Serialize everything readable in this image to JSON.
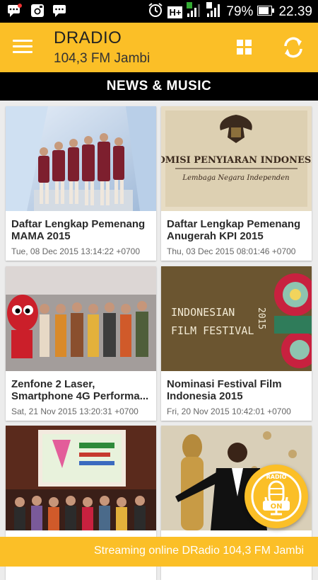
{
  "statusbar": {
    "battery_pct": "79%",
    "time": "22.39",
    "network": "H+",
    "sim1": "1",
    "sim2": "2"
  },
  "appbar": {
    "title": "DRADIO",
    "subtitle": "104,3 FM Jambi"
  },
  "section": {
    "title": "NEWS & MUSIC"
  },
  "cards": [
    {
      "title_line1": "Daftar Lengkap Pemenang",
      "title_line2": "MAMA 2015",
      "date": "Tue, 08 Dec 2015 13:14:22 +0700"
    },
    {
      "title_line1": "Daftar Lengkap Pemenang",
      "title_line2": "Anugerah KPI 2015",
      "date": "Thu, 03 Dec 2015 08:01:46 +0700",
      "image_text_1": "KOMISI PENYIARAN INDONESIA",
      "image_text_2": "Lembaga Negara Independen"
    },
    {
      "title_line1": "Zenfone 2 Laser,",
      "title_line2": "Smartphone 4G Performa...",
      "date": "Sat, 21 Nov 2015 13:20:31 +0700"
    },
    {
      "title_line1": "Nominasi Festival Film",
      "title_line2": "Indonesia 2015",
      "date": "Fri, 20 Nov 2015 10:42:01 +0700",
      "image_text_1": "INDONESIAN",
      "image_text_2": "FILM FESTIVAL",
      "image_text_3": "2015"
    },
    {
      "title_line1": "",
      "title_line2": "",
      "date": ""
    },
    {
      "title_line1": "",
      "title_line2": "",
      "date": ""
    }
  ],
  "ticker": {
    "text": "Streaming online DRadio 104,3 FM Jambi"
  },
  "radio_button": {
    "top_label": "RADIO",
    "bottom_label": "ON"
  },
  "colors": {
    "accent": "#fbbf27",
    "bar": "#000000"
  }
}
